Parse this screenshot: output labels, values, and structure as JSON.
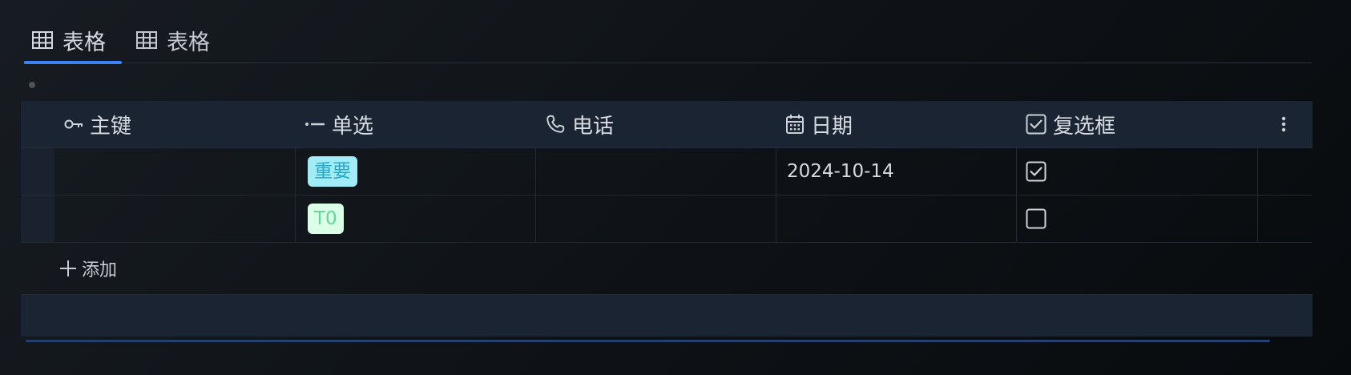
{
  "tabs": [
    {
      "label": "表格",
      "icon": "table-icon",
      "active": true
    },
    {
      "label": "表格",
      "icon": "table-icon",
      "active": false
    }
  ],
  "colors": {
    "accent": "#3b82f6",
    "header_bg": "#1b2433",
    "tag_important_bg": "#a2ecf7",
    "tag_important_text": "#23a7c7",
    "tag_t0_bg": "#dcffe8",
    "tag_t0_text": "#5fd69a"
  },
  "columns": [
    {
      "label": "主键",
      "icon": "key-icon"
    },
    {
      "label": "单选",
      "icon": "single-select-icon"
    },
    {
      "label": "电话",
      "icon": "phone-icon"
    },
    {
      "label": "日期",
      "icon": "calendar-icon"
    },
    {
      "label": "复选框",
      "icon": "checkbox-icon"
    }
  ],
  "header_menu_icon": "more-vertical-icon",
  "rows": [
    {
      "primary_key": "",
      "single_select": "重要",
      "phone": "",
      "date": "2024-10-14",
      "checked": true
    },
    {
      "primary_key": "",
      "single_select": "T0",
      "phone": "",
      "date": "",
      "checked": false
    }
  ],
  "add_label": "添加"
}
